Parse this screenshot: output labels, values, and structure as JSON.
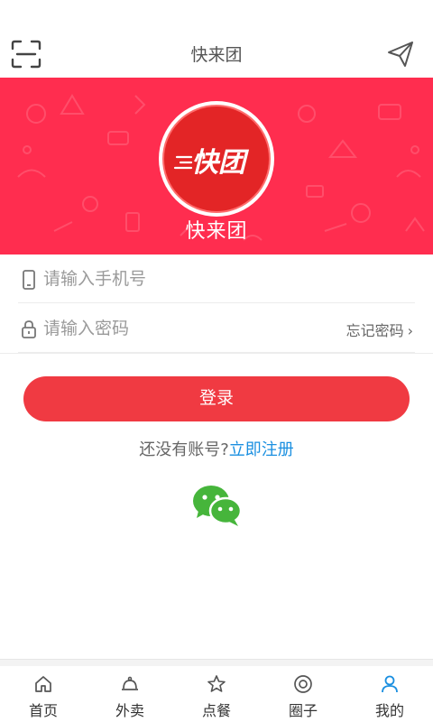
{
  "header": {
    "title": "快来团",
    "left_icon": "scan-icon",
    "right_icon": "send-icon"
  },
  "banner": {
    "logo_text": "快团",
    "brand_name": "快来团",
    "bg_color": "#ff2d4f"
  },
  "form": {
    "phone_placeholder": "请输入手机号",
    "password_placeholder": "请输入密码",
    "forgot_label": "忘记密码",
    "login_label": "登录",
    "register_prompt": "还没有账号?",
    "register_link": "立即注册",
    "accent_color": "#f03a42",
    "link_color": "#1a8fe0"
  },
  "social": {
    "wechat_icon": "wechat-icon"
  },
  "tabbar": {
    "items": [
      {
        "label": "首页",
        "icon": "home-icon"
      },
      {
        "label": "外卖",
        "icon": "cloche-icon"
      },
      {
        "label": "点餐",
        "icon": "star-icon"
      },
      {
        "label": "圈子",
        "icon": "circle-icon"
      },
      {
        "label": "我的",
        "icon": "user-icon",
        "active": true
      }
    ]
  }
}
